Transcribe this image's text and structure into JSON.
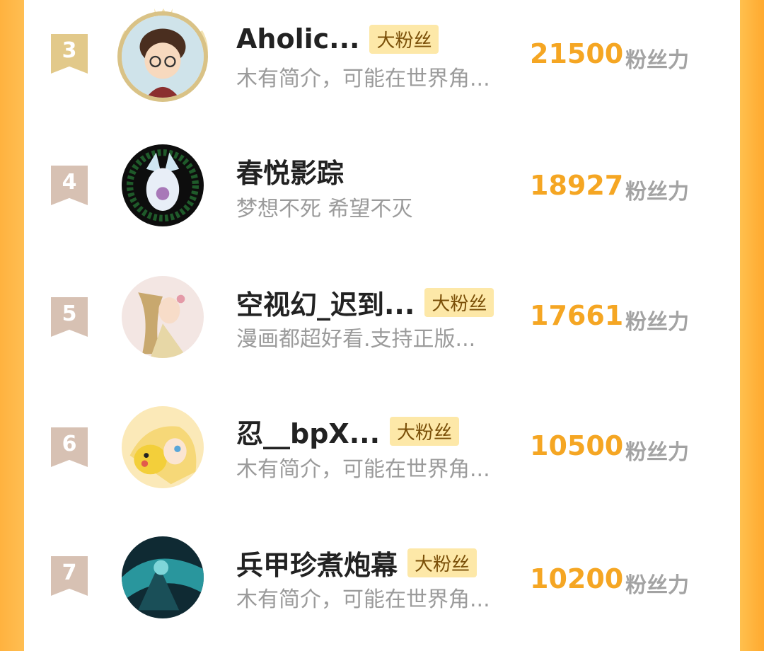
{
  "colors": {
    "accent": "#f5a623",
    "badge_bg": "#fde8a8",
    "badge_text": "#7a4f08",
    "bio": "#9b9b9b",
    "unit": "#a3a3a3",
    "rank_gold": "#e2c98a",
    "rank_default": "#d7c1b3"
  },
  "fans": [
    {
      "rank": "3",
      "name": "Aholic...",
      "badge": "大粉丝",
      "bio": "木有简介，可能在世界角...",
      "score": "21500",
      "unit": "粉丝力",
      "avatar_icon": "cartoon-boy-avatar"
    },
    {
      "rank": "4",
      "name": "春悦影踪",
      "badge": "",
      "bio": "梦想不死 希望不灭",
      "score": "18927",
      "unit": "粉丝力",
      "avatar_icon": "fox-girl-avatar"
    },
    {
      "rank": "5",
      "name": "空视幻_迟到...",
      "badge": "大粉丝",
      "bio": "漫画都超好看.支持正版...",
      "score": "17661",
      "unit": "粉丝力",
      "avatar_icon": "anime-girl-avatar"
    },
    {
      "rank": "6",
      "name": "忍__bpX...",
      "badge": "大粉丝",
      "bio": "木有简介，可能在世界角...",
      "score": "10500",
      "unit": "粉丝力",
      "avatar_icon": "pikachu-girl-avatar"
    },
    {
      "rank": "7",
      "name": "兵甲珍煮炮幕",
      "badge": "大粉丝",
      "bio": "木有简介，可能在世界角...",
      "score": "10200",
      "unit": "粉丝力",
      "avatar_icon": "dark-warrior-avatar"
    }
  ]
}
